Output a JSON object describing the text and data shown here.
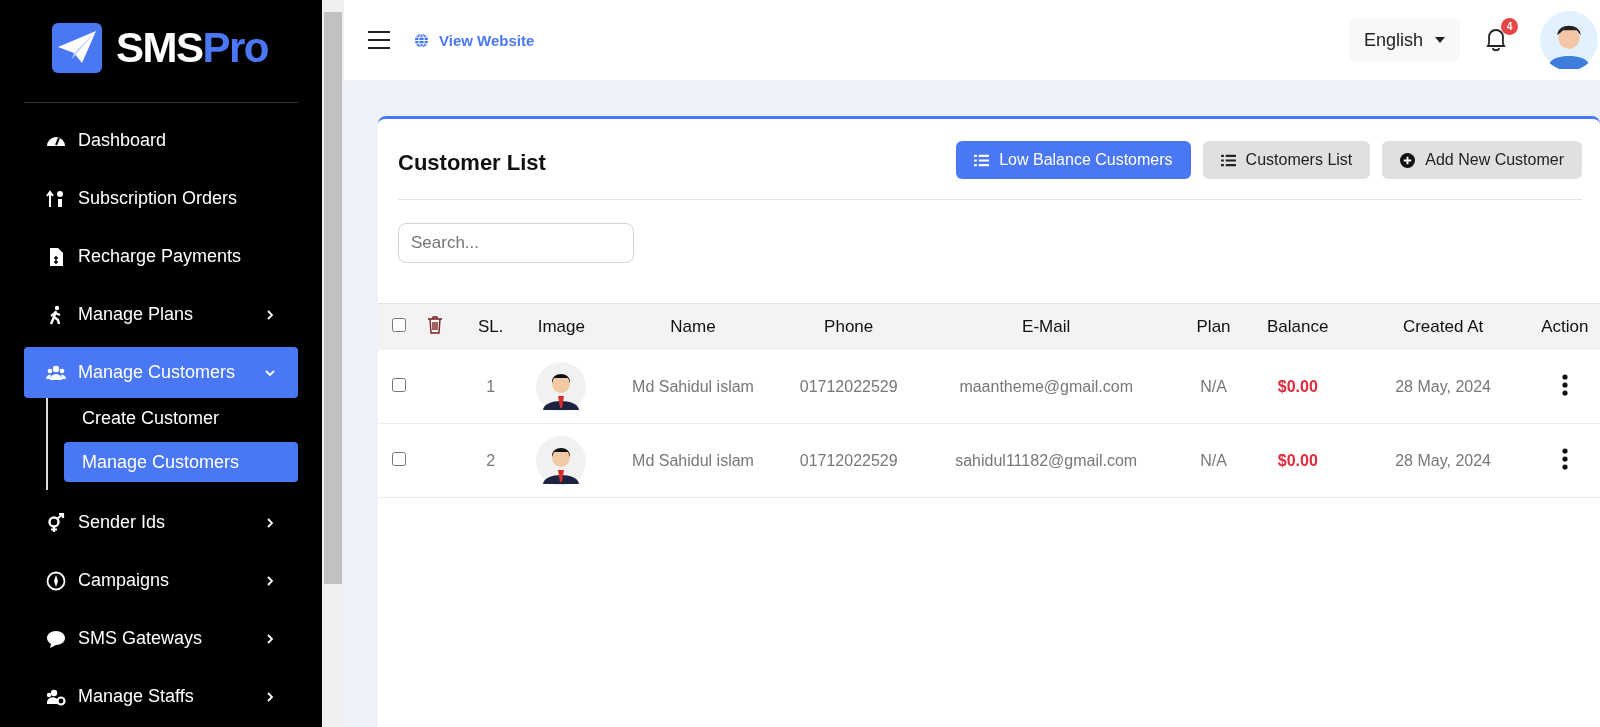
{
  "brand": {
    "name": "SMS",
    "accent": "Pro"
  },
  "sidebar": {
    "items": [
      {
        "label": "Dashboard",
        "kind": "link",
        "selected": false
      },
      {
        "label": "Subscription Orders",
        "kind": "link",
        "selected": false
      },
      {
        "label": "Recharge Payments",
        "kind": "link",
        "selected": false
      },
      {
        "label": "Manage Plans",
        "kind": "group",
        "selected": false,
        "expanded": false
      },
      {
        "label": "Manage Customers",
        "kind": "group",
        "selected": true,
        "expanded": true,
        "children": [
          {
            "label": "Create Customer",
            "selected": false
          },
          {
            "label": "Manage Customers",
            "selected": true
          }
        ]
      },
      {
        "label": "Sender Ids",
        "kind": "group",
        "selected": false,
        "expanded": false
      },
      {
        "label": "Campaigns",
        "kind": "group",
        "selected": false,
        "expanded": false
      },
      {
        "label": "SMS Gateways",
        "kind": "group",
        "selected": false,
        "expanded": false
      },
      {
        "label": "Manage Staffs",
        "kind": "group",
        "selected": false,
        "expanded": false
      }
    ]
  },
  "topbar": {
    "view_website": "View Website",
    "language": "English",
    "notification_count": "4"
  },
  "card": {
    "title": "Customer List",
    "buttons": [
      {
        "label": "Low Balance Customers",
        "selected": true
      },
      {
        "label": "Customers List",
        "selected": false
      },
      {
        "label": "Add New Customer",
        "selected": false
      }
    ],
    "search": {
      "placeholder": "Search..."
    }
  },
  "table": {
    "columns": [
      "SL.",
      "Image",
      "Name",
      "Phone",
      "E-Mail",
      "Plan",
      "Balance",
      "Created At",
      "Action"
    ],
    "select_all_checked": false,
    "rows": [
      {
        "checked": false,
        "sl": "1",
        "name": "Md Sahidul islam",
        "phone": "01712022529",
        "email": "maantheme@gmail.com",
        "plan": "N/A",
        "balance": "$0.00",
        "created_at": "28 May, 2024"
      },
      {
        "checked": false,
        "sl": "2",
        "name": "Md Sahidul islam",
        "phone": "01712022529",
        "email": "sahidul11182@gmail.com",
        "plan": "N/A",
        "balance": "$0.00",
        "created_at": "28 May, 2024"
      }
    ]
  }
}
